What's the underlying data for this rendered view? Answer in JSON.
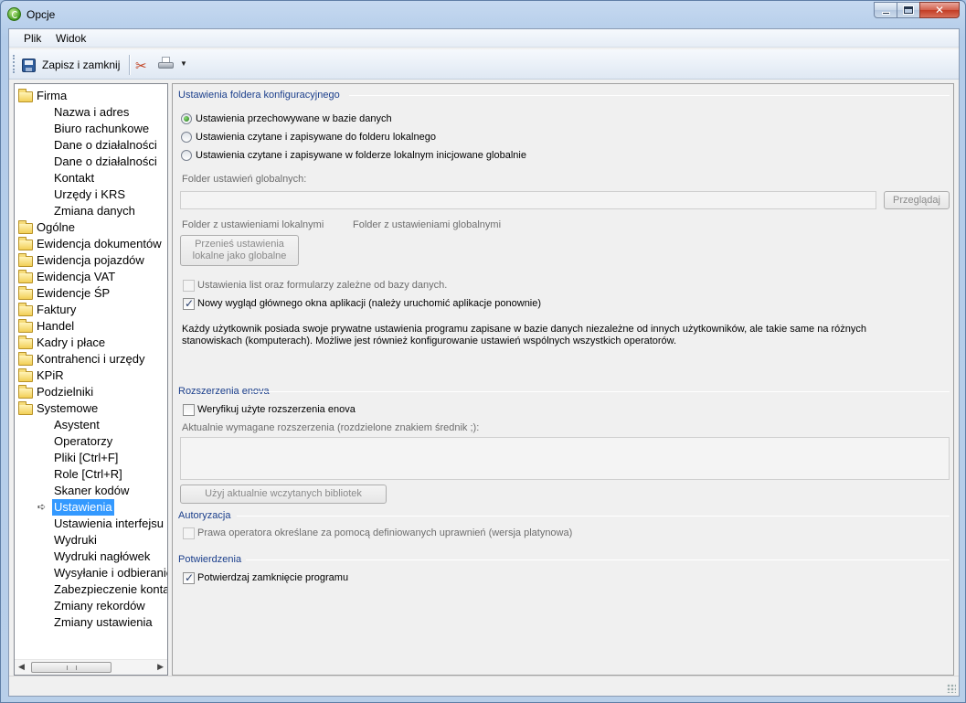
{
  "window": {
    "title": "Opcje"
  },
  "menu": [
    {
      "label": "Plik"
    },
    {
      "label": "Widok"
    }
  ],
  "toolbar": {
    "save_label": "Zapisz i zamknij",
    "dropdown_glyph": "▼"
  },
  "tree": {
    "items": [
      {
        "label": "Firma",
        "level": 0
      },
      {
        "label": "Nazwa i adres",
        "level": 1
      },
      {
        "label": "Biuro rachunkowe",
        "level": 1
      },
      {
        "label": "Dane o działalności",
        "level": 1
      },
      {
        "label": "Dane o działalności",
        "level": 1
      },
      {
        "label": "Kontakt",
        "level": 1
      },
      {
        "label": "Urzędy i KRS",
        "level": 1
      },
      {
        "label": "Zmiana danych",
        "level": 1
      },
      {
        "label": "Ogólne",
        "level": 0
      },
      {
        "label": "Ewidencja dokumentów",
        "level": 0
      },
      {
        "label": "Ewidencja pojazdów",
        "level": 0
      },
      {
        "label": "Ewidencja VAT",
        "level": 0
      },
      {
        "label": "Ewidencje ŚP",
        "level": 0
      },
      {
        "label": "Faktury",
        "level": 0
      },
      {
        "label": "Handel",
        "level": 0
      },
      {
        "label": "Kadry i płace",
        "level": 0
      },
      {
        "label": "Kontrahenci i urzędy",
        "level": 0
      },
      {
        "label": "KPiR",
        "level": 0
      },
      {
        "label": "Podzielniki",
        "level": 0
      },
      {
        "label": "Systemowe",
        "level": 0
      },
      {
        "label": "Asystent",
        "level": 1
      },
      {
        "label": "Operatorzy",
        "level": 1
      },
      {
        "label": "Pliki [Ctrl+F]",
        "level": 1
      },
      {
        "label": "Role [Ctrl+R]",
        "level": 1
      },
      {
        "label": "Skaner kodów",
        "level": 1
      },
      {
        "label": "Ustawienia",
        "level": 1,
        "selected": true
      },
      {
        "label": "Ustawienia interfejsu",
        "level": 1
      },
      {
        "label": "Wydruki",
        "level": 1
      },
      {
        "label": "Wydruki nagłówek",
        "level": 1
      },
      {
        "label": "Wysyłanie i odbieranie",
        "level": 1
      },
      {
        "label": "Zabezpieczenie konta",
        "level": 1
      },
      {
        "label": "Zmiany rekordów",
        "level": 1
      },
      {
        "label": "Zmiany ustawienia",
        "level": 1
      }
    ],
    "selected_marker": "➪"
  },
  "config_folder": {
    "title": "Ustawienia foldera konfiguracyjnego",
    "radios": [
      {
        "label": "Ustawienia przechowywane w bazie danych",
        "checked": true
      },
      {
        "label": "Ustawienia czytane i zapisywane do folderu lokalnego",
        "checked": false
      },
      {
        "label": "Ustawienia czytane i zapisywane w folderze lokalnym inicjowane globalnie",
        "checked": false
      }
    ],
    "global_folder_label": "Folder ustawień globalnych:",
    "global_folder_value": "",
    "browse_button": "Przeglądaj",
    "local_folder_link": "Folder z ustawieniami lokalnymi",
    "global_folder_link": "Folder z ustawieniami globalnymi",
    "move_button": "Przenieś ustawienia lokalne jako globalne",
    "list_settings_label": "Ustawienia list oraz formularzy zależne od bazy danych.",
    "new_look_label": "Nowy wygląd głównego okna aplikacji (należy uruchomić aplikacje ponownie)",
    "new_look_checked": true,
    "info_text": "Każdy użytkownik posiada swoje prywatne ustawienia programu zapisane w bazie danych niezależne od innych użytkowników, ale takie same na różnych stanowiskach (komputerach). Możliwe jest również konfigurowanie ustawień wspólnych wszystkich operatorów."
  },
  "extensions": {
    "title": "Rozszerzenia enova",
    "verify_label": "Weryfikuj użyte rozszerzenia enova",
    "verify_checked": false,
    "required_label": "Aktualnie wymagane rozszerzenia (rozdzielone znakiem średnik ;):",
    "required_value": "",
    "use_loaded_button": "Użyj aktualnie wczytanych bibliotek"
  },
  "authorization": {
    "title": "Autoryzacja",
    "rights_label": "Prawa operatora określane za pomocą definiowanych uprawnień (wersja platynowa)"
  },
  "confirmations": {
    "title": "Potwierdzenia",
    "confirm_close_label": "Potwierdzaj zamknięcie programu",
    "confirm_close_checked": true
  }
}
